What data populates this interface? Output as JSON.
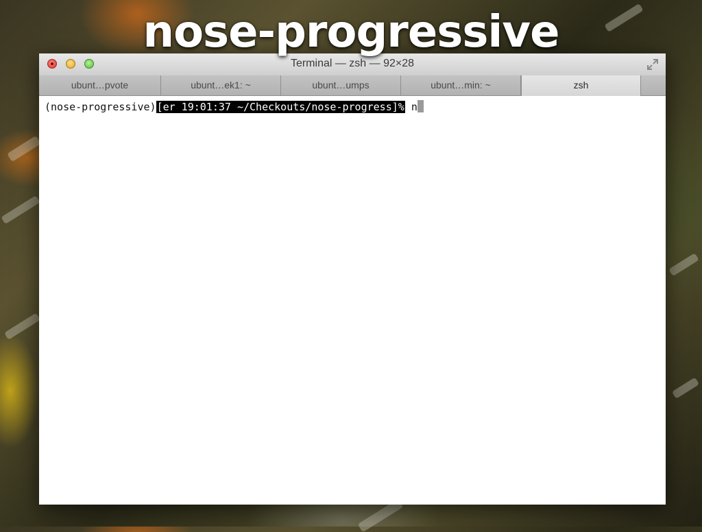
{
  "slide": {
    "title": "nose-progressive"
  },
  "window": {
    "title": "Terminal — zsh — 92×28",
    "tabs": [
      {
        "label": "ubunt…pvote"
      },
      {
        "label": "ubunt…ek1: ~"
      },
      {
        "label": "ubunt…umps"
      },
      {
        "label": "ubunt…min: ~"
      },
      {
        "label": "zsh"
      }
    ]
  },
  "terminal": {
    "env": "(nose-progressive)",
    "prompt": "[er 19:01:37 ~/Checkouts/nose-progress]%",
    "typed": "n"
  },
  "icons": {
    "close": "close-button-icon",
    "minimize": "minimize-button-icon",
    "zoom": "zoom-button-icon",
    "fullscreen": "fullscreen-arrows-icon"
  },
  "colors": {
    "close": "#d8302a",
    "minimize": "#e0a21f",
    "zoom": "#55b93a",
    "prompt_bg": "#000000",
    "prompt_fg": "#ffffff"
  }
}
